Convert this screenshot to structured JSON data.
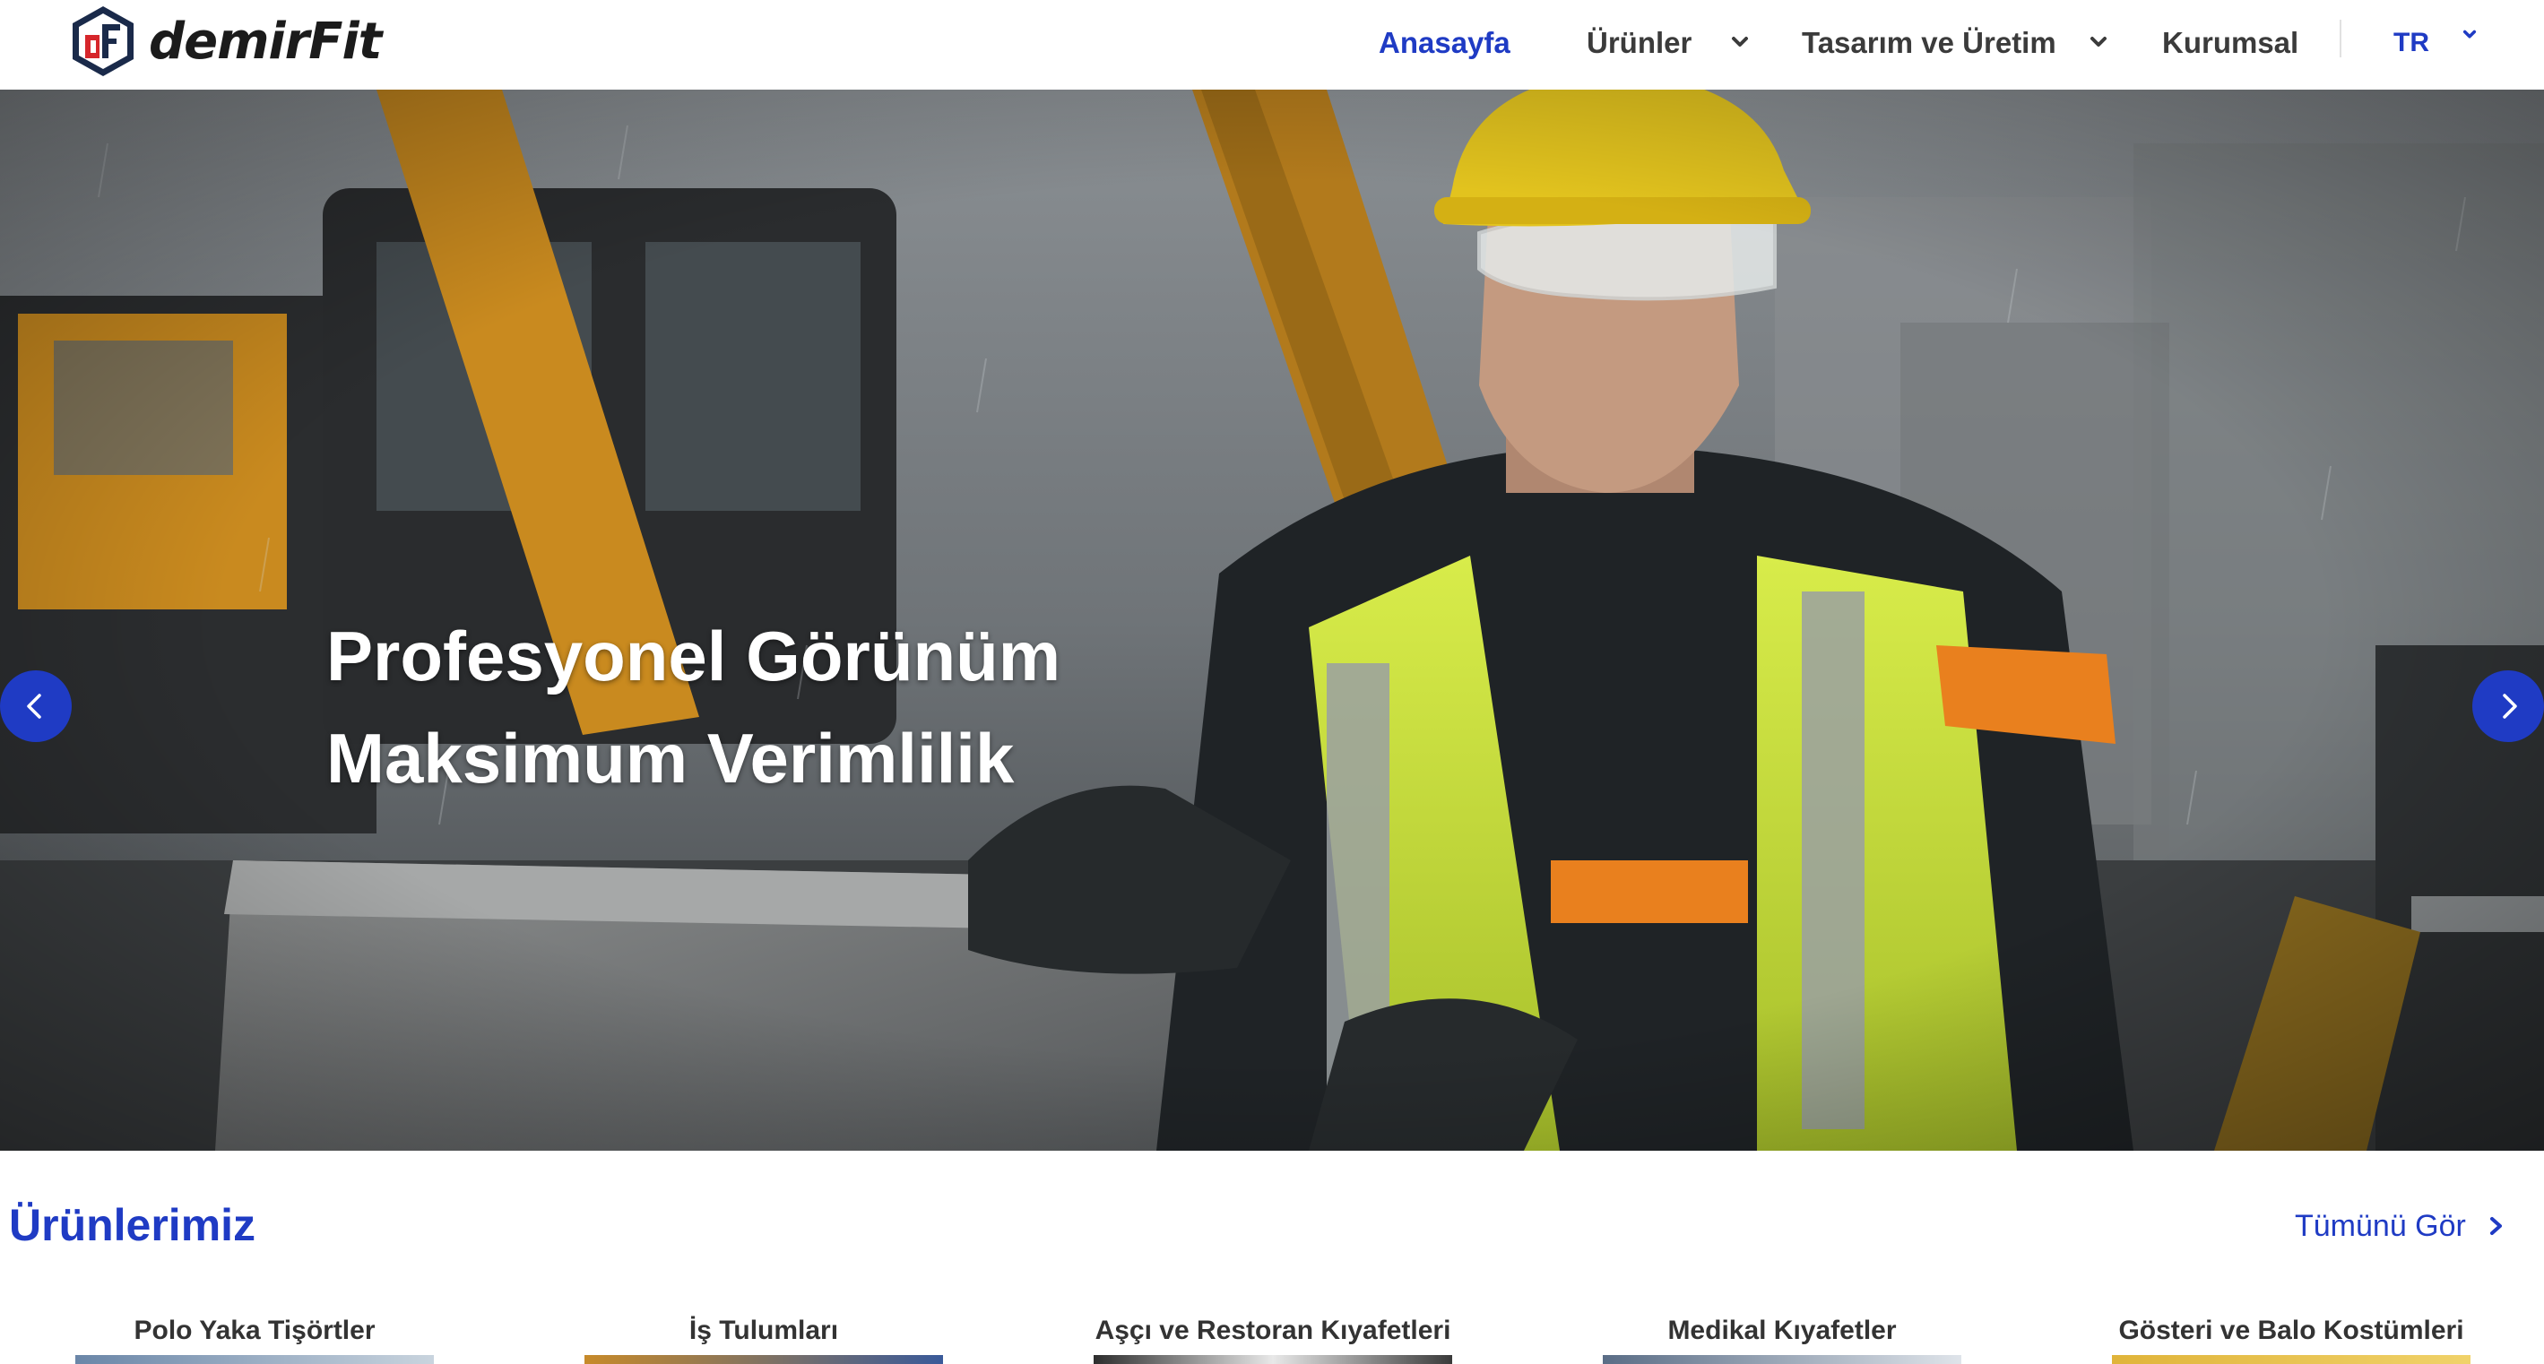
{
  "brand": {
    "name": "demirFit",
    "logo_letters": "dF"
  },
  "nav": {
    "items": [
      {
        "label": "Anasayfa",
        "active": true,
        "has_dropdown": false
      },
      {
        "label": "Ürünler",
        "active": false,
        "has_dropdown": true
      },
      {
        "label": "Tasarım ve Üretim",
        "active": false,
        "has_dropdown": true
      },
      {
        "label": "Kurumsal",
        "active": false,
        "has_dropdown": false
      }
    ],
    "language": "TR"
  },
  "hero": {
    "line1": "Profesyonel Görünüm",
    "line2": "Maksimum Verimlilik",
    "image_subject": "construction worker in yellow hard hat, safety glasses and high-visibility vest leaning on concrete block in the rain, excavator in background"
  },
  "products": {
    "title": "Ürünlerimiz",
    "see_all": "Tümünü Gör",
    "items": [
      {
        "label": "Polo Yaka Tişörtler"
      },
      {
        "label": "İş Tulumları"
      },
      {
        "label": "Aşçı ve Restoran Kıyafetleri"
      },
      {
        "label": "Medikal Kıyafetler"
      },
      {
        "label": "Gösteri ve Balo Kostümleri"
      }
    ]
  },
  "colors": {
    "accent": "#1f3bc4",
    "nav_text": "#3b3b3b",
    "logo_red": "#d6262b",
    "logo_navy": "#1a2a4a"
  }
}
